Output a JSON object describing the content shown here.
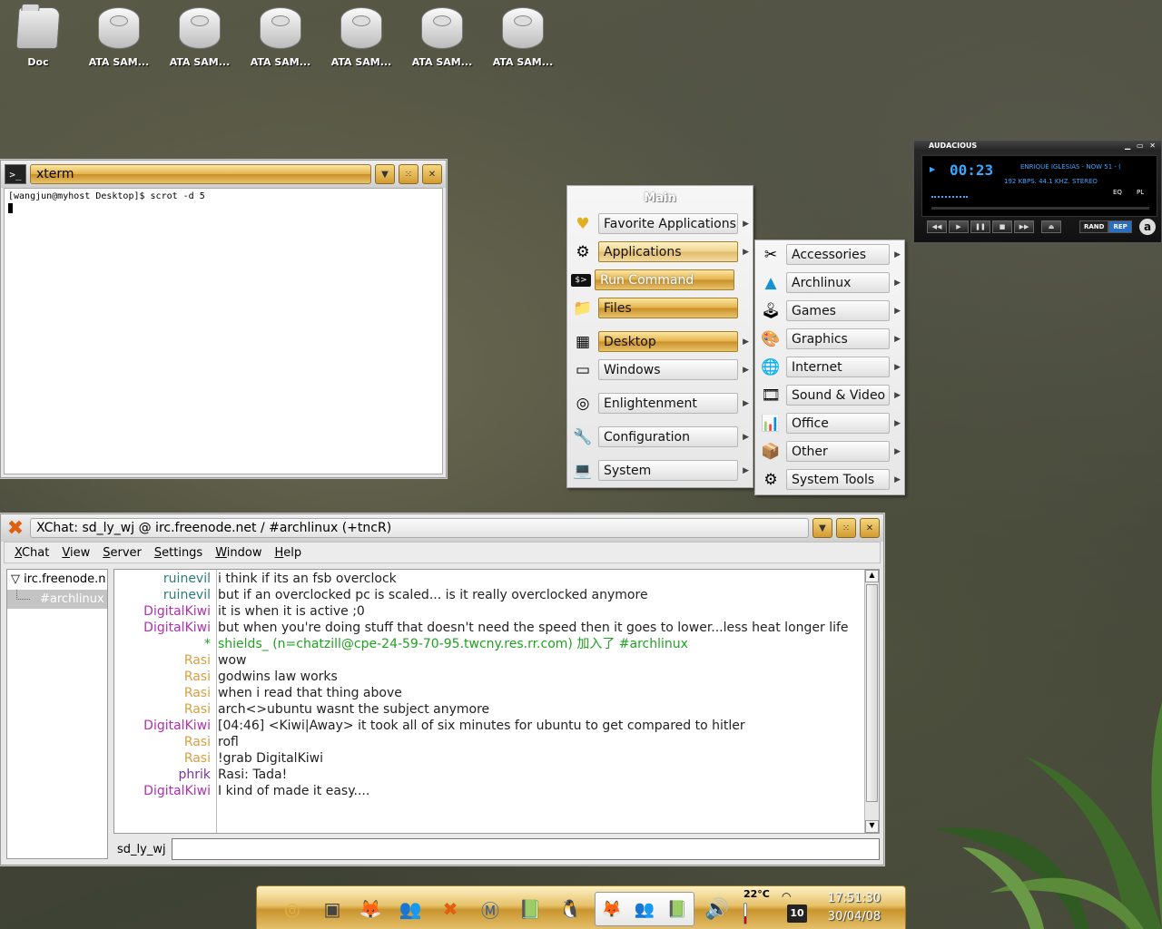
{
  "desktop": {
    "icons": [
      {
        "label": "Doc",
        "type": "folder"
      },
      {
        "label": "ATA SAM...",
        "type": "drive"
      },
      {
        "label": "ATA SAM...",
        "type": "drive"
      },
      {
        "label": "ATA SAM...",
        "type": "drive"
      },
      {
        "label": "ATA SAM...",
        "type": "drive"
      },
      {
        "label": "ATA SAM...",
        "type": "drive"
      },
      {
        "label": "ATA SAM...",
        "type": "drive"
      }
    ]
  },
  "xterm": {
    "title": "xterm",
    "prompt_line": "[wangjun@myhost Desktop]$ scrot -d 5",
    "icon": "terminal-icon"
  },
  "emenu": {
    "title": "Main",
    "items": [
      {
        "label": "Favorite Applications",
        "icon": "heart-icon",
        "glyph": "♥",
        "style": "plain",
        "submenu": true
      },
      {
        "label": "Applications",
        "icon": "gear-icon",
        "glyph": "⚙",
        "style": "gold-light",
        "submenu": true
      },
      {
        "label": "Run Command",
        "icon": "terminal-icon",
        "glyph": "$>",
        "style": "gold-dim",
        "submenu": false
      },
      {
        "label": "Files",
        "icon": "folder-icon",
        "glyph": "📁",
        "style": "gold",
        "submenu": false
      },
      {
        "label": "Desktop",
        "icon": "desktop-icon",
        "glyph": "▦",
        "style": "gold",
        "submenu": true
      },
      {
        "label": "Windows",
        "icon": "window-icon",
        "glyph": "▭",
        "style": "plain",
        "submenu": true
      },
      {
        "label": "Enlightenment",
        "icon": "e-logo-icon",
        "glyph": "◎",
        "style": "plain",
        "submenu": true
      },
      {
        "label": "Configuration",
        "icon": "wrench-icon",
        "glyph": "🔧",
        "style": "plain",
        "submenu": true
      },
      {
        "label": "System",
        "icon": "laptop-icon",
        "glyph": "💻",
        "style": "plain",
        "submenu": true
      }
    ],
    "submenu_items": [
      {
        "label": "Accessories",
        "icon": "accessories-icon",
        "glyph": "✂"
      },
      {
        "label": "Archlinux",
        "icon": "archlinux-icon",
        "glyph": "▲"
      },
      {
        "label": "Games",
        "icon": "joystick-icon",
        "glyph": "🕹"
      },
      {
        "label": "Graphics",
        "icon": "palette-icon",
        "glyph": "🎨"
      },
      {
        "label": "Internet",
        "icon": "globe-icon",
        "glyph": "🌐"
      },
      {
        "label": "Sound & Video",
        "icon": "media-icon",
        "glyph": "🎞"
      },
      {
        "label": "Office",
        "icon": "office-icon",
        "glyph": "📊"
      },
      {
        "label": "Other",
        "icon": "other-icon",
        "glyph": "📦"
      },
      {
        "label": "System Tools",
        "icon": "system-tools-icon",
        "glyph": "⚙"
      }
    ]
  },
  "audacious": {
    "title": "AUDACIOUS",
    "time": "00:23",
    "song": "ENRIQUE IGLESIAS - NOW 51 - (",
    "info": "192 KBPS. 44.1 KHZ. STEREO",
    "eq_label": "EQ",
    "pl_label": "PL",
    "rand_label": "RAND",
    "rep_label": "REP",
    "logo": "a",
    "buttons": [
      "◀◀",
      "▶",
      "❚❚",
      "■",
      "▶▶",
      "⏏"
    ]
  },
  "xchat": {
    "title": "XChat: sd_ly_wj @ irc.freenode.net / #archlinux (+tncR)",
    "menu": [
      {
        "accel": "X",
        "rest": "Chat"
      },
      {
        "accel": "V",
        "rest": "iew"
      },
      {
        "accel": "S",
        "rest": "erver"
      },
      {
        "accel": "S",
        "rest": "ettings"
      },
      {
        "accel": "W",
        "rest": "indow"
      },
      {
        "accel": "H",
        "rest": "elp"
      }
    ],
    "server": "irc.freenode.n",
    "channel": "#archlinux",
    "nickname": "sd_ly_wj",
    "colors": {
      "ruinevil": "#2d7a7a",
      "DigitalKiwi": "#b030b0",
      "Rasi": "#d4a040",
      "phrik": "#8030a0",
      "join": "#22a022"
    },
    "lines": [
      {
        "nick": "ruinevil",
        "msg": "i think if its an fsb overclock",
        "kind": "ruinevil"
      },
      {
        "nick": "ruinevil",
        "msg": "but if an overclocked pc is scaled... is it really overclocked anymore",
        "kind": "ruinevil"
      },
      {
        "nick": "DigitalKiwi",
        "msg": "it is when it is active ;0",
        "kind": "DigitalKiwi"
      },
      {
        "nick": "DigitalKiwi",
        "msg": "but when you're doing stuff that doesn't need the speed then it goes to lower...less heat longer life",
        "kind": "DigitalKiwi"
      },
      {
        "nick": "*",
        "msg": "shields_ (n=chatzill@cpe-24-59-70-95.twcny.res.rr.com) 加入了 #archlinux",
        "kind": "join"
      },
      {
        "nick": "Rasi",
        "msg": "wow",
        "kind": "Rasi"
      },
      {
        "nick": "Rasi",
        "msg": "godwins law works",
        "kind": "Rasi"
      },
      {
        "nick": "Rasi",
        "msg": "when i read that thing above",
        "kind": "Rasi"
      },
      {
        "nick": "Rasi",
        "msg": "arch<>ubuntu wasnt the subject anymore",
        "kind": "Rasi"
      },
      {
        "nick": "DigitalKiwi",
        "msg": "[04:46] <Kiwi|Away> it took all of six minutes for ubuntu to get compared to hitler",
        "kind": "DigitalKiwi"
      },
      {
        "nick": "Rasi",
        "msg": "rofl",
        "kind": "Rasi"
      },
      {
        "nick": "Rasi",
        "msg": "!grab DigitalKiwi",
        "kind": "Rasi"
      },
      {
        "nick": "phrik",
        "msg": "Rasi: Tada!",
        "kind": "phrik"
      },
      {
        "nick": "DigitalKiwi",
        "msg": "I kind of made it easy....",
        "kind": "DigitalKiwi"
      }
    ]
  },
  "panel": {
    "temperature": "22°C",
    "time": "17:51:30",
    "date": "30/04/08",
    "badge": "10",
    "launchers": [
      {
        "name": "enlightenment-icon",
        "glyph": "◎"
      },
      {
        "name": "terminal-icon",
        "glyph": "▣"
      },
      {
        "name": "firefox-icon",
        "glyph": "🦊"
      },
      {
        "name": "messenger-icon",
        "glyph": "👥"
      },
      {
        "name": "xchat-icon",
        "glyph": "✖"
      },
      {
        "name": "mms-icon",
        "glyph": "Ⓜ"
      },
      {
        "name": "book-icon",
        "glyph": "📗"
      },
      {
        "name": "penguin-icon",
        "glyph": "🐧"
      }
    ],
    "pager_glyphs": [
      "🦊",
      "👥",
      "📗"
    ]
  }
}
